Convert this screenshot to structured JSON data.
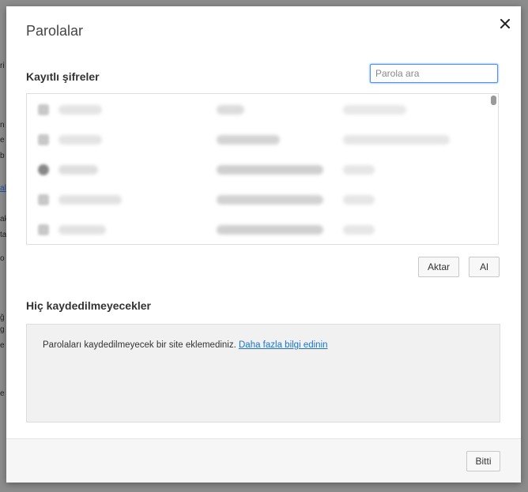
{
  "dialog": {
    "title": "Parolalar",
    "close_icon": "close-icon"
  },
  "saved": {
    "heading": "Kayıtlı şifreler",
    "search_placeholder": "Parola ara"
  },
  "actions": {
    "export_label": "Aktar",
    "import_label": "Al"
  },
  "never_saved": {
    "heading": "Hiç kaydedilmeyecekler",
    "message": "Parolaları kaydedilmeyecek bir site eklemediniz.",
    "learn_more_link": "Daha fazla bilgi edinin"
  },
  "footer": {
    "done_label": "Bitti"
  },
  "colors": {
    "accent": "#4d90fe",
    "link": "#1a73c8",
    "box_bg": "#f1f1f1"
  }
}
